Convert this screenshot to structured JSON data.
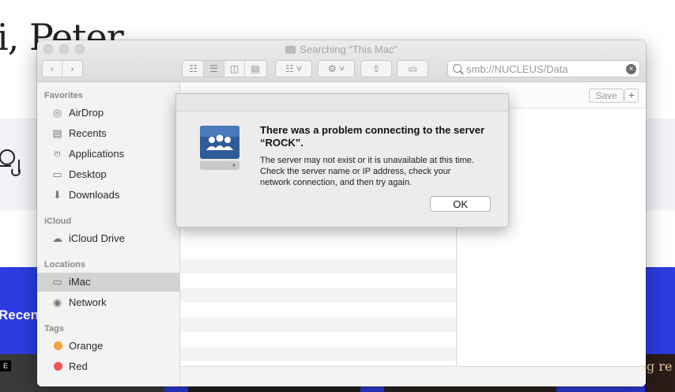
{
  "background_page": {
    "heading": "i, Peter",
    "recent_label": "Recent",
    "badge_letter": "E",
    "right_text": "g re"
  },
  "window": {
    "title": "Searching “This Mac”",
    "search": {
      "value": "smb://NUCLEUS/Data"
    },
    "save_label": "Save",
    "plus_label": "+"
  },
  "sidebar": {
    "favorites_header": "Favorites",
    "favorites": [
      {
        "label": "AirDrop",
        "icon": "airdrop-icon"
      },
      {
        "label": "Recents",
        "icon": "recents-icon"
      },
      {
        "label": "Applications",
        "icon": "applications-icon"
      },
      {
        "label": "Desktop",
        "icon": "desktop-icon"
      },
      {
        "label": "Downloads",
        "icon": "downloads-icon"
      }
    ],
    "icloud_header": "iCloud",
    "icloud": [
      {
        "label": "iCloud Drive",
        "icon": "cloud-icon"
      }
    ],
    "locations_header": "Locations",
    "locations": [
      {
        "label": "iMac",
        "icon": "imac-icon",
        "selected": true
      },
      {
        "label": "Network",
        "icon": "network-icon"
      }
    ],
    "tags_header": "Tags",
    "tags": [
      {
        "label": "Orange",
        "color": "#f5a33a"
      },
      {
        "label": "Red",
        "color": "#ee5454"
      }
    ]
  },
  "dialog": {
    "title": "There was a problem connecting to the server “ROCK”.",
    "message": "The server may not exist or it is unavailable at this time. Check the server name or IP address, check your network connection, and then try again.",
    "ok_label": "OK",
    "icon": "network-server-icon"
  },
  "colors": {
    "page_blue": "#2c3ce0",
    "sidebar_selected": "#d2d2d2"
  }
}
